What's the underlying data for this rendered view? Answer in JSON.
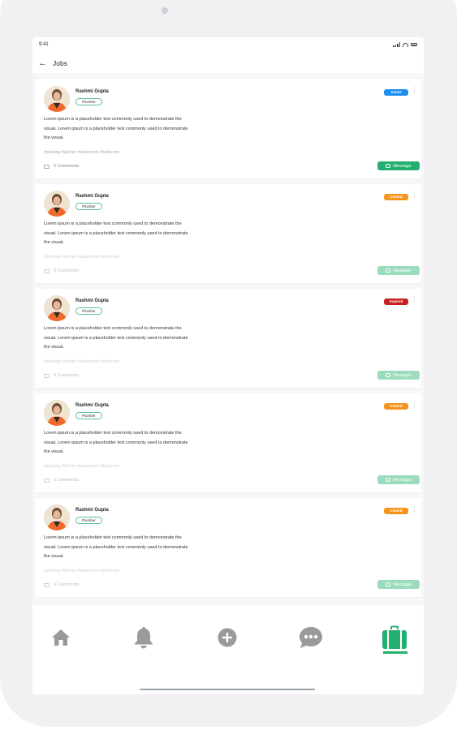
{
  "status_bar": {
    "time": "9:41"
  },
  "header": {
    "title": "Jobs"
  },
  "jobs": [
    {
      "name": "Rashmi Gupta",
      "role": "Plumber",
      "status": "Active",
      "status_color": "#1e8ef0",
      "description": "Lorem ipsum is a placeholder text commonly used to demonstrate the visual. Lorem ipsum is a placeholder text commonly used to demonstrate the visual.",
      "tags": "#painting #kitchen #washroom #bathroom",
      "comments": "5 Comments",
      "message_label": "Message",
      "faded": false
    },
    {
      "name": "Rashmi Gupta",
      "role": "Plumber",
      "status": "Closed",
      "status_color": "#f5941e",
      "description": "Lorem ipsum is a placeholder text commonly used to demonstrate the visual. Lorem ipsum is a placeholder text commonly used to demonstrate the visual.",
      "tags": "#painting #kitchen #washroom #bathroom",
      "comments": "5 Comments",
      "message_label": "Message",
      "faded": true
    },
    {
      "name": "Rashmi Gupta",
      "role": "Plumber",
      "status": "Expired",
      "status_color": "#c81e1e",
      "description": "Lorem ipsum is a placeholder text commonly used to demonstrate the visual. Lorem ipsum is a placeholder text commonly used to demonstrate the visual.",
      "tags": "#painting #kitchen #washroom #bathroom",
      "comments": "5 Comments",
      "message_label": "Message",
      "faded": true
    },
    {
      "name": "Rashmi Gupta",
      "role": "Plumber",
      "status": "Closed",
      "status_color": "#f5941e",
      "description": "Lorem ipsum is a placeholder text commonly used to demonstrate the visual. Lorem ipsum is a placeholder text commonly used to demonstrate the visual.",
      "tags": "#painting #kitchen #washroom #bathroom",
      "comments": "5 Comments",
      "message_label": "Message",
      "faded": true
    },
    {
      "name": "Rashmi Gupta",
      "role": "Plumber",
      "status": "Closed",
      "status_color": "#f5941e",
      "description": "Lorem ipsum is a placeholder text commonly used to demonstrate the visual. Lorem ipsum is a placeholder text commonly used to demonstrate the visual.",
      "tags": "#painting #kitchen #washroom #bathroom",
      "comments": "5 Comments",
      "message_label": "Message",
      "faded": true
    }
  ],
  "bottom_nav": {
    "items": [
      {
        "icon": "home-icon"
      },
      {
        "icon": "bell-icon"
      },
      {
        "icon": "plus-circle-icon"
      },
      {
        "icon": "chat-icon"
      },
      {
        "icon": "briefcase-icon",
        "active": true
      }
    ],
    "active_color": "#23b06e",
    "inactive_color": "#9a9a9a"
  }
}
